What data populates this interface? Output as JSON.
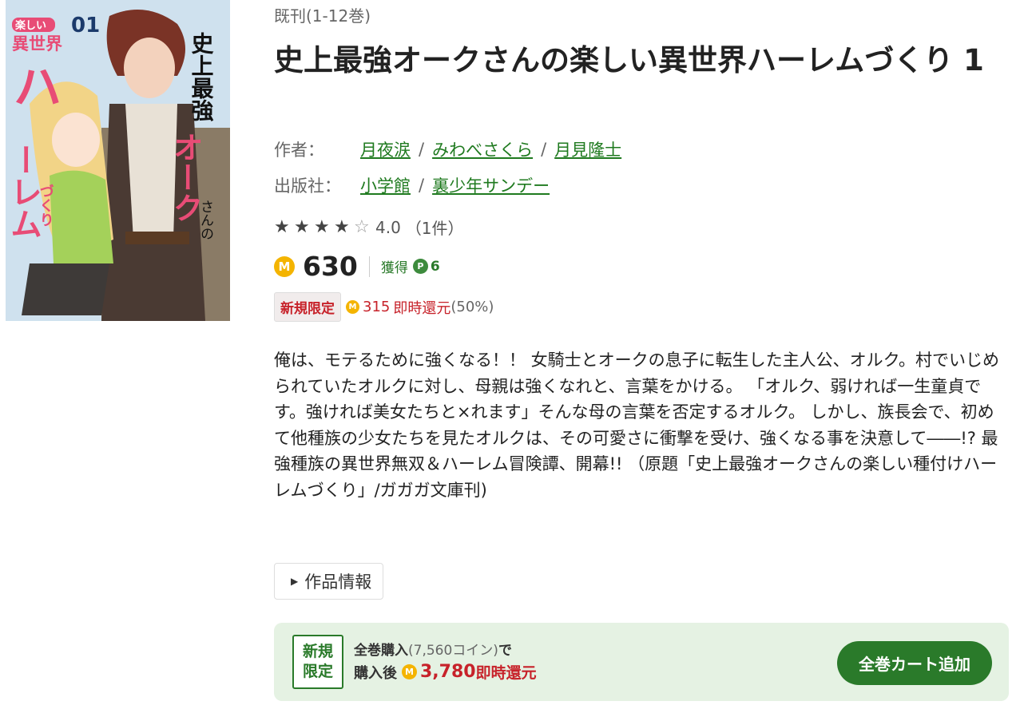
{
  "book": {
    "series_label": "既刊(1-12巻)",
    "title": "史上最強オークさんの楽しい異世界ハーレムづくり 1",
    "author_label": "作者：",
    "authors": [
      "月夜涙",
      "みわべさくら",
      "月見隆士"
    ],
    "publisher_label": "出版社：",
    "publishers": [
      "小学館",
      "裏少年サンデー"
    ],
    "rating_value": "4.0",
    "rating_count": "（1件）",
    "stars_filled": 4,
    "stars_total": 5
  },
  "cover": {
    "volume_number": "01",
    "title_text": "史上最強オークさんの楽しい異世界ハーレムづくり"
  },
  "price": {
    "coin_symbol": "M",
    "amount": "630",
    "earn_label": "獲得",
    "point_symbol": "P",
    "earn_points": "6"
  },
  "promo": {
    "badge": "新規限定",
    "amount": "315",
    "text": "即時還元",
    "percent": "(50%)"
  },
  "description": "俺は、モテるために強くなる！！ 女騎士とオークの息子に転生した主人公、オルク。村でいじめられていたオルクに対し、母親は強くなれと、言葉をかける。 「オルク、弱ければ一生童貞です。強ければ美女たちと×れます」そんな母の言葉を否定するオルク。 しかし、族長会で、初めて他種族の少女たちを見たオルクは、その可愛さに衝撃を受け、強くなる事を決意して――!? 最強種族の異世界無双＆ハーレム冒険譚、開幕!! （原題「史上最強オークさんの楽しい種付けハーレムづくり」/ガガガ文庫刊)",
  "info_button": "作品情報",
  "bundle": {
    "badge_line1": "新規",
    "badge_line2": "限定",
    "line1_bold": "全巻購入",
    "line1_coins": "(7,560コイン)",
    "line1_end": "で",
    "line2_prefix": "購入後",
    "line2_amount": "3,780",
    "line2_suffix": "即時還元",
    "cart_button": "全巻カート追加"
  },
  "colors": {
    "link_green": "#1f7a1f",
    "accent_red": "#c7222a",
    "coin_gold": "#f4b400",
    "bundle_bg": "#e5f2e3",
    "button_green": "#2a7a2a"
  }
}
